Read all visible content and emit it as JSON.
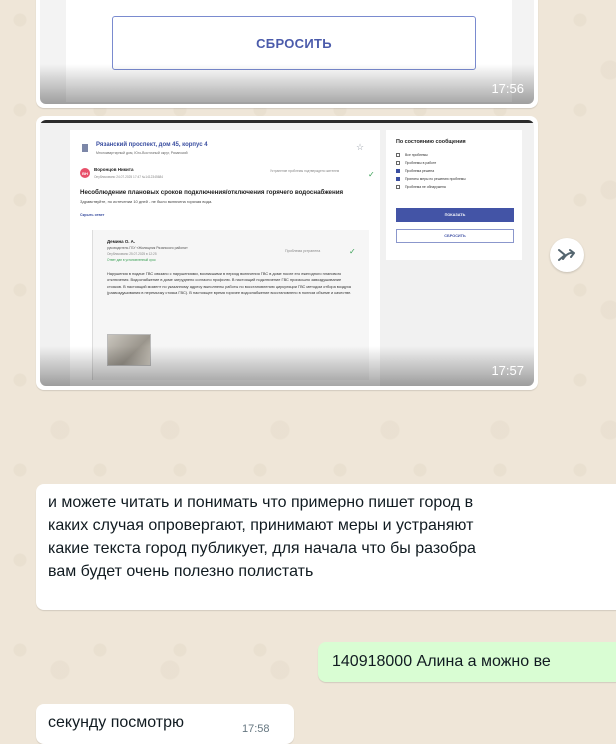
{
  "chat": {
    "message1": {
      "button_label": "СБРОСИТЬ",
      "time": "17:56"
    },
    "message2": {
      "time": "17:57",
      "screenshot": {
        "address": "Рязанский проспект, дом 45, корпус 4",
        "address_sub": "Многоквартирный дом, Юго-Восточный округ, Рязанский",
        "author_initials": "ВН",
        "author": "Воронцов Никита",
        "posted": "Опубликовано 24.07.2025 17:47  №1412345684",
        "status_text": "Устранение проблемы подтверждено жителем",
        "problem_title": "Несоблюдение плановых сроков подключения/отключения горячего водоснабжения",
        "problem_desc": "Здравствуйте, по истечении 10 дней - не было включена горячая вода.",
        "hide_answer": "Скрыть ответ",
        "reply": {
          "name": "Демина О. А.",
          "role": "руководитель ГБУ «Жилищник Рязанского района»",
          "date": "Опубликовано 25.07.2025 в 12:25",
          "deadline": "Ответ дан в установленный срок",
          "status": "Проблема устранена",
          "body": "Нарушения в подаче ГВС связано с нарушениями, возникшими в период включения ГВС в доме после его ежегодного планового отключения. Водоснабжение в доме затруднено согласно профилю. В настоящий подключение ГВС произошло завоздушивание стояков. В настоящий момент по указанному адресу выполнены работы по восстановлению циркуляции ГВС методом отбора воздуха (развоздушивания в перемычку стояка ГВС). В настоящее время горячее водоснабжение восстановлено в полном объеме и качестве."
        },
        "filter": {
          "title": "По состоянию сообщения",
          "options": [
            {
              "label": "Все проблемы",
              "checked": false
            },
            {
              "label": "Проблемы в работе",
              "checked": false
            },
            {
              "label": "Проблема решена",
              "checked": true
            },
            {
              "label": "Приняты меры по решению проблемы",
              "checked": true
            },
            {
              "label": "Проблема не обнаружена",
              "checked": false
            }
          ],
          "show_label": "ПОКАЗАТЬ",
          "reset_label": "СБРОСИТЬ"
        }
      }
    },
    "message3": {
      "lines": [
        "и можете читать и понимать что примерно пишет город в",
        "каких случая опровергают, принимают меры и устраняют",
        "какие текста город публикует, для начала что бы разобра",
        "вам будет очень полезно полистать"
      ]
    },
    "message4": {
      "text": "140918000 Алина а можно ве"
    },
    "message5": {
      "text": "секунду посмотрю",
      "time": "17:58"
    }
  }
}
